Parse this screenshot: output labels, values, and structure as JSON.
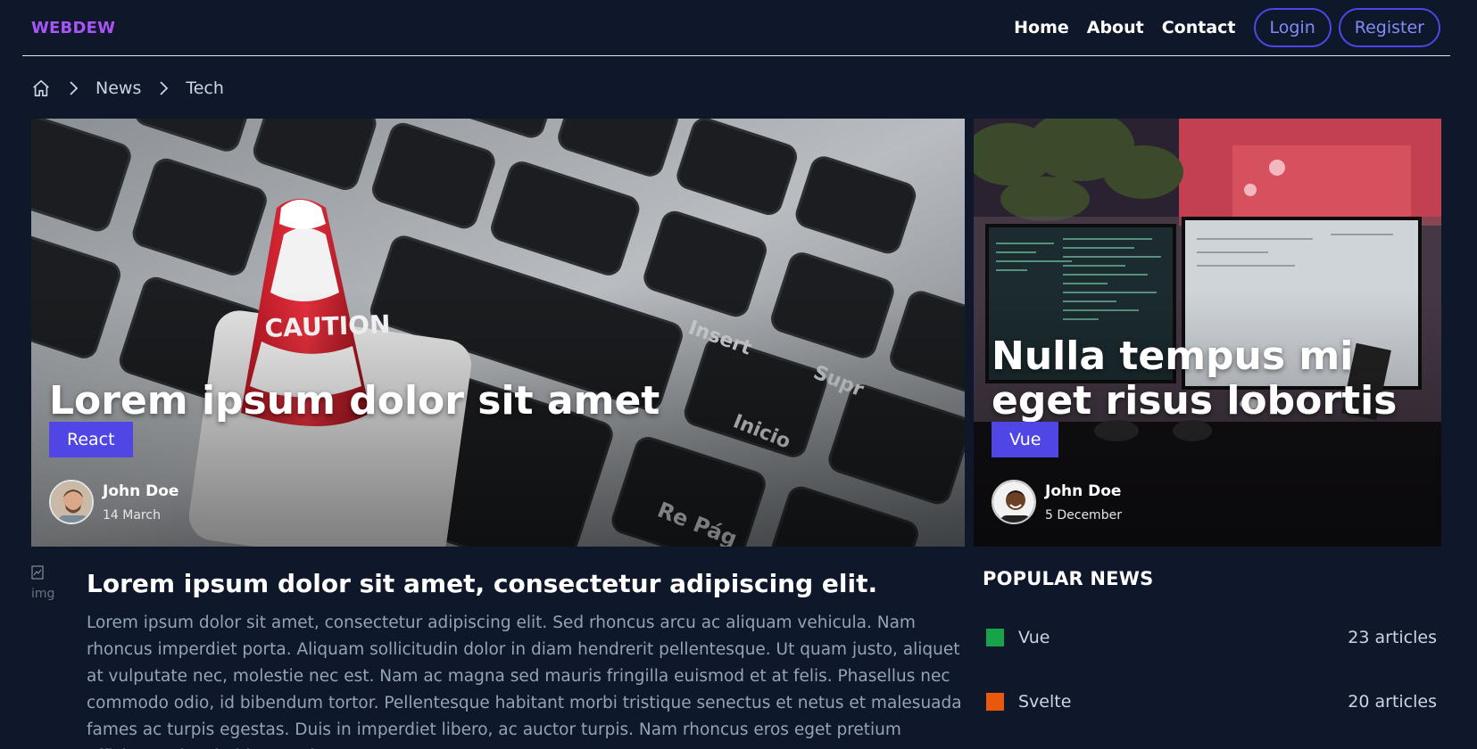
{
  "header": {
    "logo": "WEBDEW",
    "nav": [
      "Home",
      "About",
      "Contact"
    ],
    "login": "Login",
    "register": "Register"
  },
  "breadcrumb": {
    "items": [
      "News",
      "Tech"
    ]
  },
  "hero": [
    {
      "title": "Lorem ipsum dolor sit amet",
      "tag": "React",
      "author": "John Doe",
      "date": "14 March"
    },
    {
      "title": "Nulla tempus mi eget risus lobortis",
      "tag": "Vue",
      "author": "John Doe",
      "date": "5 December"
    }
  ],
  "article": {
    "img_alt": "img",
    "title": "Lorem ipsum dolor sit amet, consectetur adipiscing elit.",
    "body": "Lorem ipsum dolor sit amet, consectetur adipiscing elit. Sed rhoncus arcu ac aliquam vehicula. Nam rhoncus imperdiet porta. Aliquam sollicitudin dolor in diam hendrerit pellentesque. Ut quam justo, aliquet at vulputate nec, molestie nec est. Nam ac magna sed mauris fringilla euismod et at felis. Phasellus nec commodo odio, id bibendum tortor. Pellentesque habitant morbi tristique senectus et netus et malesuada fames ac turpis egestas. Duis in imperdiet libero, ac auctor turpis. Nam rhoncus eros eget pretium efficitur. In hac habitasse platea"
  },
  "popular": {
    "title": "POPULAR NEWS",
    "items": [
      {
        "label": "Vue",
        "count": "23 articles",
        "color": "#16a34a"
      },
      {
        "label": "Svelte",
        "count": "20 articles",
        "color": "#ea580c"
      }
    ]
  },
  "colors": {
    "background": "#0f172a",
    "logo": "#a855f7",
    "accent": "#4f46e5"
  }
}
